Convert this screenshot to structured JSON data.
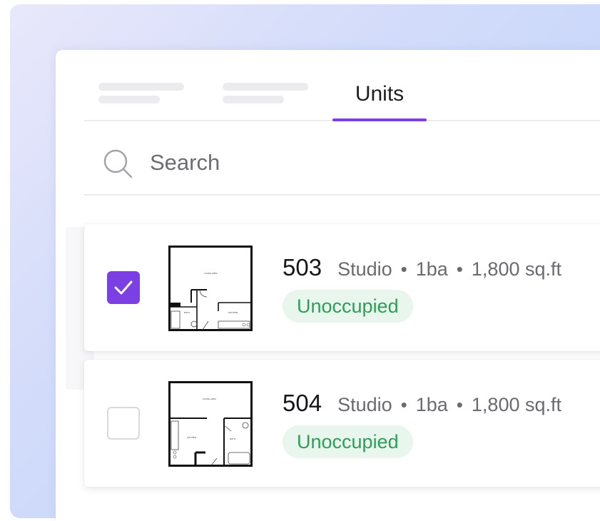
{
  "tabs": {
    "active_label": "Units"
  },
  "search": {
    "placeholder": "Search"
  },
  "units": [
    {
      "number": "503",
      "type": "Studio",
      "baths": "1ba",
      "area": "1,800 sq.ft",
      "status": "Unoccupied",
      "selected": true
    },
    {
      "number": "504",
      "type": "Studio",
      "baths": "1ba",
      "area": "1,800 sq.ft",
      "status": "Unoccupied",
      "selected": false
    }
  ],
  "separator": "•",
  "colors": {
    "accent": "#7b3fe4",
    "status_text": "#2e9d5a",
    "status_bg": "#e9f6ee"
  },
  "icons": {
    "search": "search-icon",
    "check": "check-icon",
    "floorplan": "floorplan-thumbnail"
  }
}
